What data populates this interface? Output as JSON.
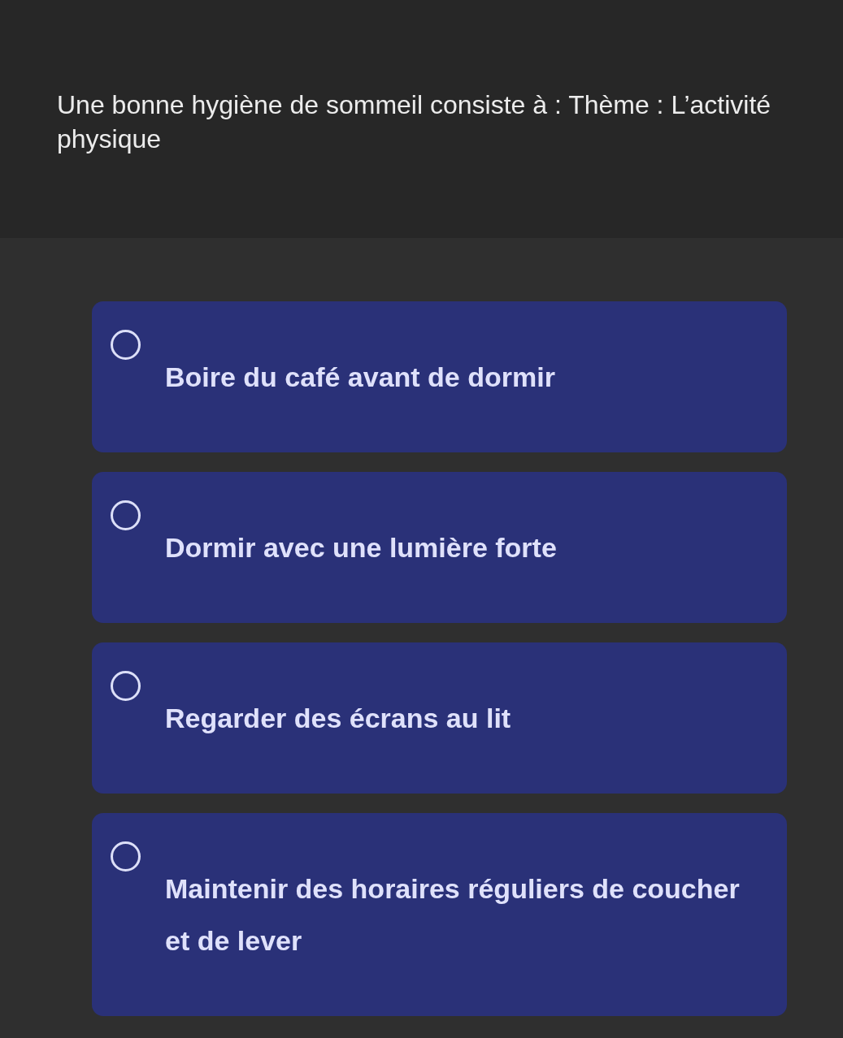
{
  "question": "Une bonne hygiène de sommeil consiste à : Thème : L’activité physique",
  "options": [
    {
      "label": "Boire du café avant de dormir",
      "selected": false
    },
    {
      "label": "Dormir avec une lumière forte",
      "selected": false
    },
    {
      "label": "Regarder des écrans au lit",
      "selected": false
    },
    {
      "label": "Maintenir des horaires réguliers de coucher et de lever",
      "selected": false
    }
  ]
}
